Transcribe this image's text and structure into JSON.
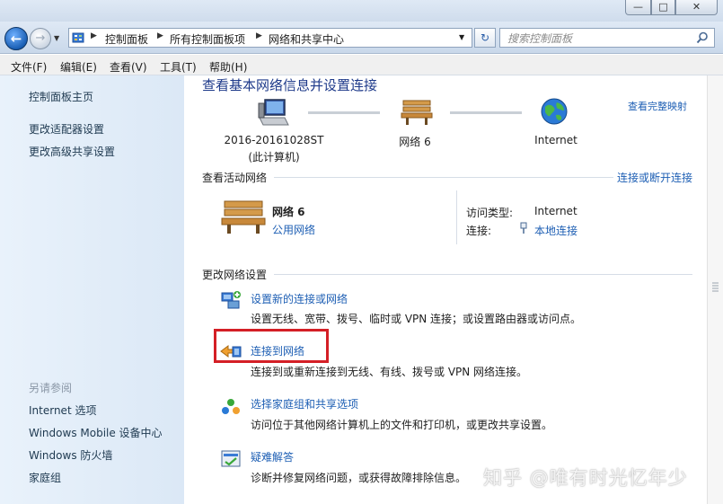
{
  "window": {
    "minimize": "—",
    "maximize": "□",
    "close": "✕"
  },
  "address": {
    "breadcrumbs": [
      "控制面板",
      "所有控制面板项",
      "网络和共享中心"
    ],
    "search_placeholder": "搜索控制面板"
  },
  "menu": [
    "文件(F)",
    "编辑(E)",
    "查看(V)",
    "工具(T)",
    "帮助(H)"
  ],
  "sidebar": {
    "top_links": [
      "控制面板主页",
      "更改适配器设置",
      "更改高级共享设置"
    ],
    "see_also_heading": "另请参阅",
    "see_also_links": [
      "Internet 选项",
      "Windows Mobile 设备中心",
      "Windows 防火墙",
      "家庭组"
    ]
  },
  "main": {
    "title": "查看基本网络信息并设置连接",
    "view_full_map": "查看完整映射",
    "network_map": {
      "computer_name": "2016-20161028ST",
      "computer_sub": "(此计算机)",
      "network": "网络  6",
      "internet": "Internet"
    },
    "active_networks": {
      "label": "查看活动网络",
      "connect_disconnect": "连接或断开连接",
      "network_name": "网络  6",
      "network_type": "公用网络",
      "access_type_label": "访问类型:",
      "access_type_value": "Internet",
      "connections_label": "连接:",
      "connections_value": "本地连接"
    },
    "change_settings": {
      "label": "更改网络设置",
      "tasks": [
        {
          "title": "设置新的连接或网络",
          "desc": "设置无线、宽带、拨号、临时或 VPN 连接；或设置路由器或访问点。"
        },
        {
          "title": "连接到网络",
          "desc": "连接到或重新连接到无线、有线、拨号或 VPN 网络连接。"
        },
        {
          "title": "选择家庭组和共享选项",
          "desc": "访问位于其他网络计算机上的文件和打印机，或更改共享设置。"
        },
        {
          "title": "疑难解答",
          "desc": "诊断并修复网络问题，或获得故障排除信息。"
        }
      ]
    }
  },
  "watermark": "知乎 @唯有时光忆年少"
}
